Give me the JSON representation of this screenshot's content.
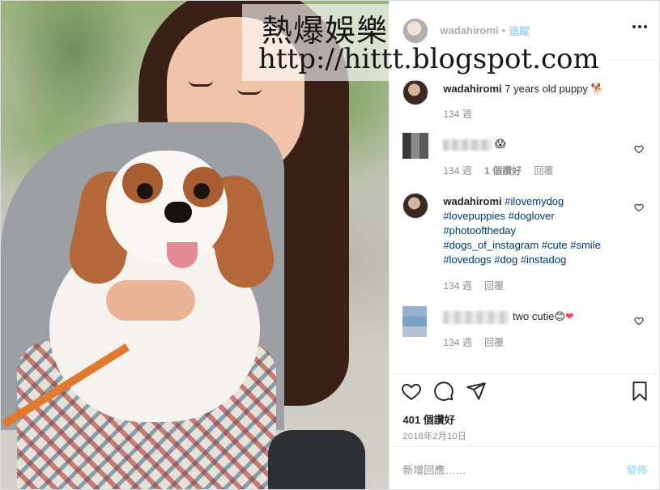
{
  "watermark": {
    "title": "熱爆娛樂",
    "url": "http://hittt.blogspot.com"
  },
  "header": {
    "username": "wadahiromi",
    "separator": "•",
    "follow_label": "追蹤"
  },
  "caption": {
    "username": "wadahiromi",
    "text": "7 years old puppy",
    "emoji": "🐕",
    "time": "134 週"
  },
  "comments": [
    {
      "emoji": "😱",
      "time": "134 週",
      "likes": "1 個讚好",
      "reply": "回覆"
    },
    {
      "username": "wadahiromi",
      "hashtags_line1": "#ilovemydog",
      "hashtags_line2": "#lovepuppies #doglover",
      "hashtags_line3": "#photooftheday",
      "hashtags_line4": "#dogs_of_instagram #cute #smile",
      "hashtags_line5": "#lovedogs #dog #instadog",
      "time": "134 週",
      "reply": "回覆"
    },
    {
      "text": "two cutie",
      "emoji": "😊",
      "heart": "❤",
      "time": "134 週",
      "reply": "回覆"
    }
  ],
  "actions": {
    "like_count": "401 個讚好",
    "date": "2018年2月10日"
  },
  "add_comment": {
    "placeholder": "新增回應……",
    "post_label": "發佈"
  },
  "colors": {
    "link": "#00376b",
    "follow": "#0095f6",
    "muted": "#8e8e8e",
    "post_disabled": "#b2dffc",
    "heart_red": "#ed4956"
  }
}
